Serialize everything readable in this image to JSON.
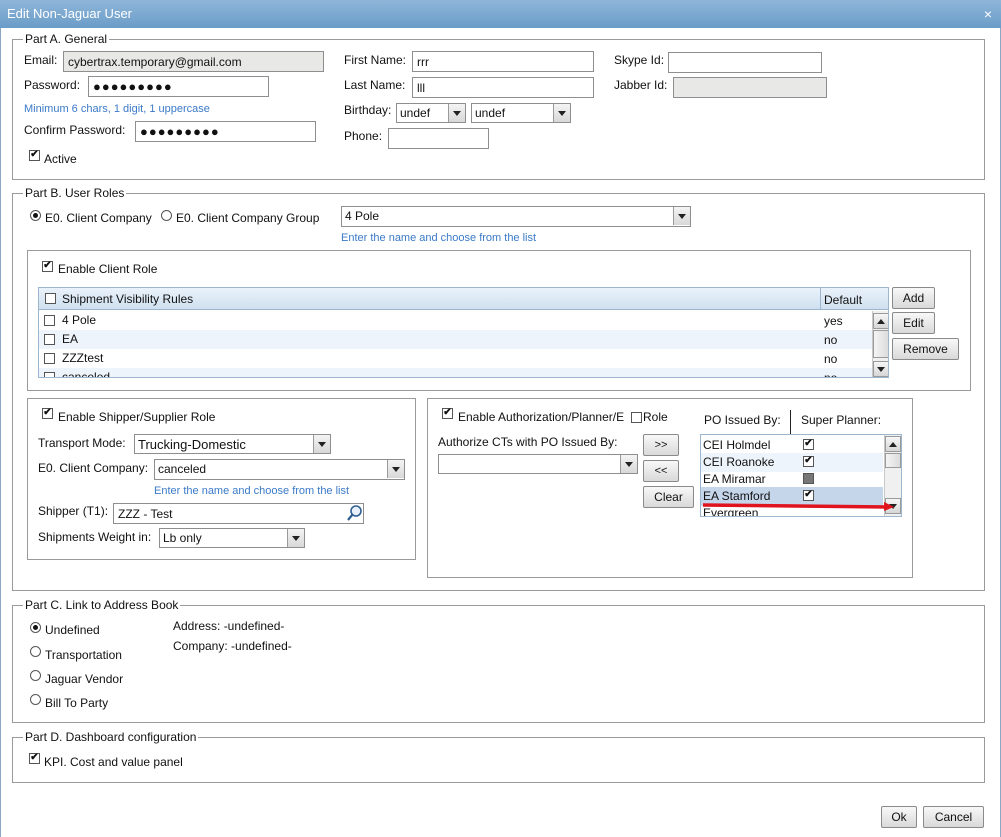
{
  "window": {
    "title": "Edit Non-Jaguar User"
  },
  "partA": {
    "legend": "Part A. General",
    "email_label": "Email:",
    "email_value": "cybertrax.temporary@gmail.com",
    "password_label": "Password:",
    "password_value": "●●●●●●●●●",
    "password_hint": "Minimum 6 chars, 1 digit, 1 uppercase",
    "confirm_label": "Confirm Password:",
    "confirm_value": "●●●●●●●●●",
    "active_label": "Active",
    "first_name_label": "First Name:",
    "first_name_value": "rrr",
    "last_name_label": "Last Name:",
    "last_name_value": "lll",
    "birthday_label": "Birthday:",
    "birthday_month": "undef",
    "birthday_day": "undef",
    "phone_label": "Phone:",
    "skype_label": "Skype Id:",
    "jabber_label": "Jabber Id:"
  },
  "partB": {
    "legend": "Part B. User Roles",
    "radio_company": "E0. Client Company",
    "radio_group": "E0. Client Company Group",
    "company_value": "4 Pole",
    "company_hint": "Enter the name and choose from the list",
    "client_role": {
      "enable_label": "Enable Client Role",
      "col_rules": "Shipment Visibility Rules",
      "col_default": "Default",
      "rows": [
        {
          "name": "4 Pole",
          "default": "yes"
        },
        {
          "name": "EA",
          "default": "no"
        },
        {
          "name": "ZZZtest",
          "default": "no"
        },
        {
          "name": "canceled",
          "default": "no"
        }
      ],
      "add": "Add",
      "edit": "Edit",
      "remove": "Remove"
    },
    "shipper_role": {
      "enable_label": "Enable Shipper/Supplier Role",
      "transport_label": "Transport Mode:",
      "transport_value": "Trucking-Domestic",
      "company_label": "E0. Client Company:",
      "company_value": "canceled",
      "company_hint": "Enter the name and choose from the list",
      "shipper_label": "Shipper (T1):",
      "shipper_value": "ZZZ - Test",
      "weight_label": "Shipments Weight in:",
      "weight_value": "Lb only"
    },
    "auth_role": {
      "enable_label": "Enable Authorization/Planner/E",
      "enable_label_tail": "Role",
      "authorize_label": "Authorize CTs with PO Issued By:",
      "move_right": ">>",
      "move_left": "<<",
      "clear": "Clear",
      "col_po": "PO Issued By:",
      "col_super": "Super Planner:",
      "rows": [
        {
          "name": "CEI Holmdel",
          "state": "checked"
        },
        {
          "name": "CEI Roanoke",
          "state": "checked"
        },
        {
          "name": "EA Miramar",
          "state": "indeterminate"
        },
        {
          "name": "EA Stamford",
          "state": "checked"
        },
        {
          "name": "Evergreen",
          "state": ""
        }
      ]
    }
  },
  "partC": {
    "legend": "Part C. Link to Address Book",
    "options": [
      "Undefined",
      "Transportation",
      "Jaguar Vendor",
      "Bill To Party"
    ],
    "address_label": "Address: -undefined-",
    "company_label": "Company: -undefined-"
  },
  "partD": {
    "legend": "Part D. Dashboard configuration",
    "kpi_label": "KPI. Cost and value panel"
  },
  "footer": {
    "ok": "Ok",
    "cancel": "Cancel"
  },
  "colors": {
    "titlebar": "#7aa7d1",
    "hint": "#3a7ac8",
    "grid_header": "#d6e5f3",
    "selected_row": "#c5d5ea",
    "annotation": "#e0141e"
  }
}
